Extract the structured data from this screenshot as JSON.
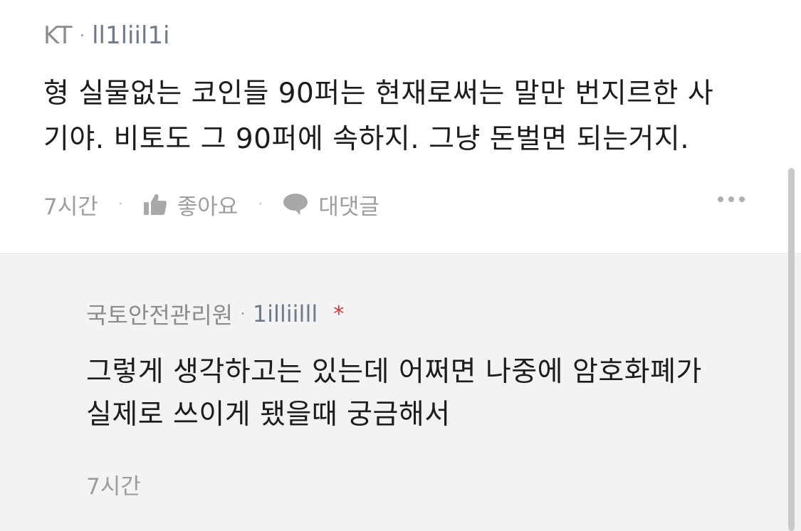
{
  "comment": {
    "author": "KT",
    "user_id": "ll1liil1i",
    "text_line1": "형 실물없는 코인들 90퍼는 현재로써는 말만 번지르한 사",
    "text_line2": "기야. 비토도 그 90퍼에 속하지. 그냥 돈벌면 되는거지.",
    "time": "7시간",
    "like_label": "좋아요",
    "reply_label": "대댓글",
    "separator": "·"
  },
  "reply": {
    "author": "국토안전관리원",
    "user_id": "1illiilll",
    "badge": "*",
    "text_line1": "그렇게 생각하고는 있는데 어쩌면 나중에 암호화폐가",
    "text_line2": "실제로 쓰이게 됐을때 궁금해서",
    "time": "7시간",
    "separator": "·"
  },
  "colors": {
    "background": "#ffffff",
    "reply_background": "#f3f3f3",
    "text": "#1c1c1c",
    "muted": "#9d9d9d",
    "badge": "#d33a3a"
  },
  "icons": [
    "thumbs-up-icon",
    "speech-bubble-icon",
    "more-icon"
  ]
}
